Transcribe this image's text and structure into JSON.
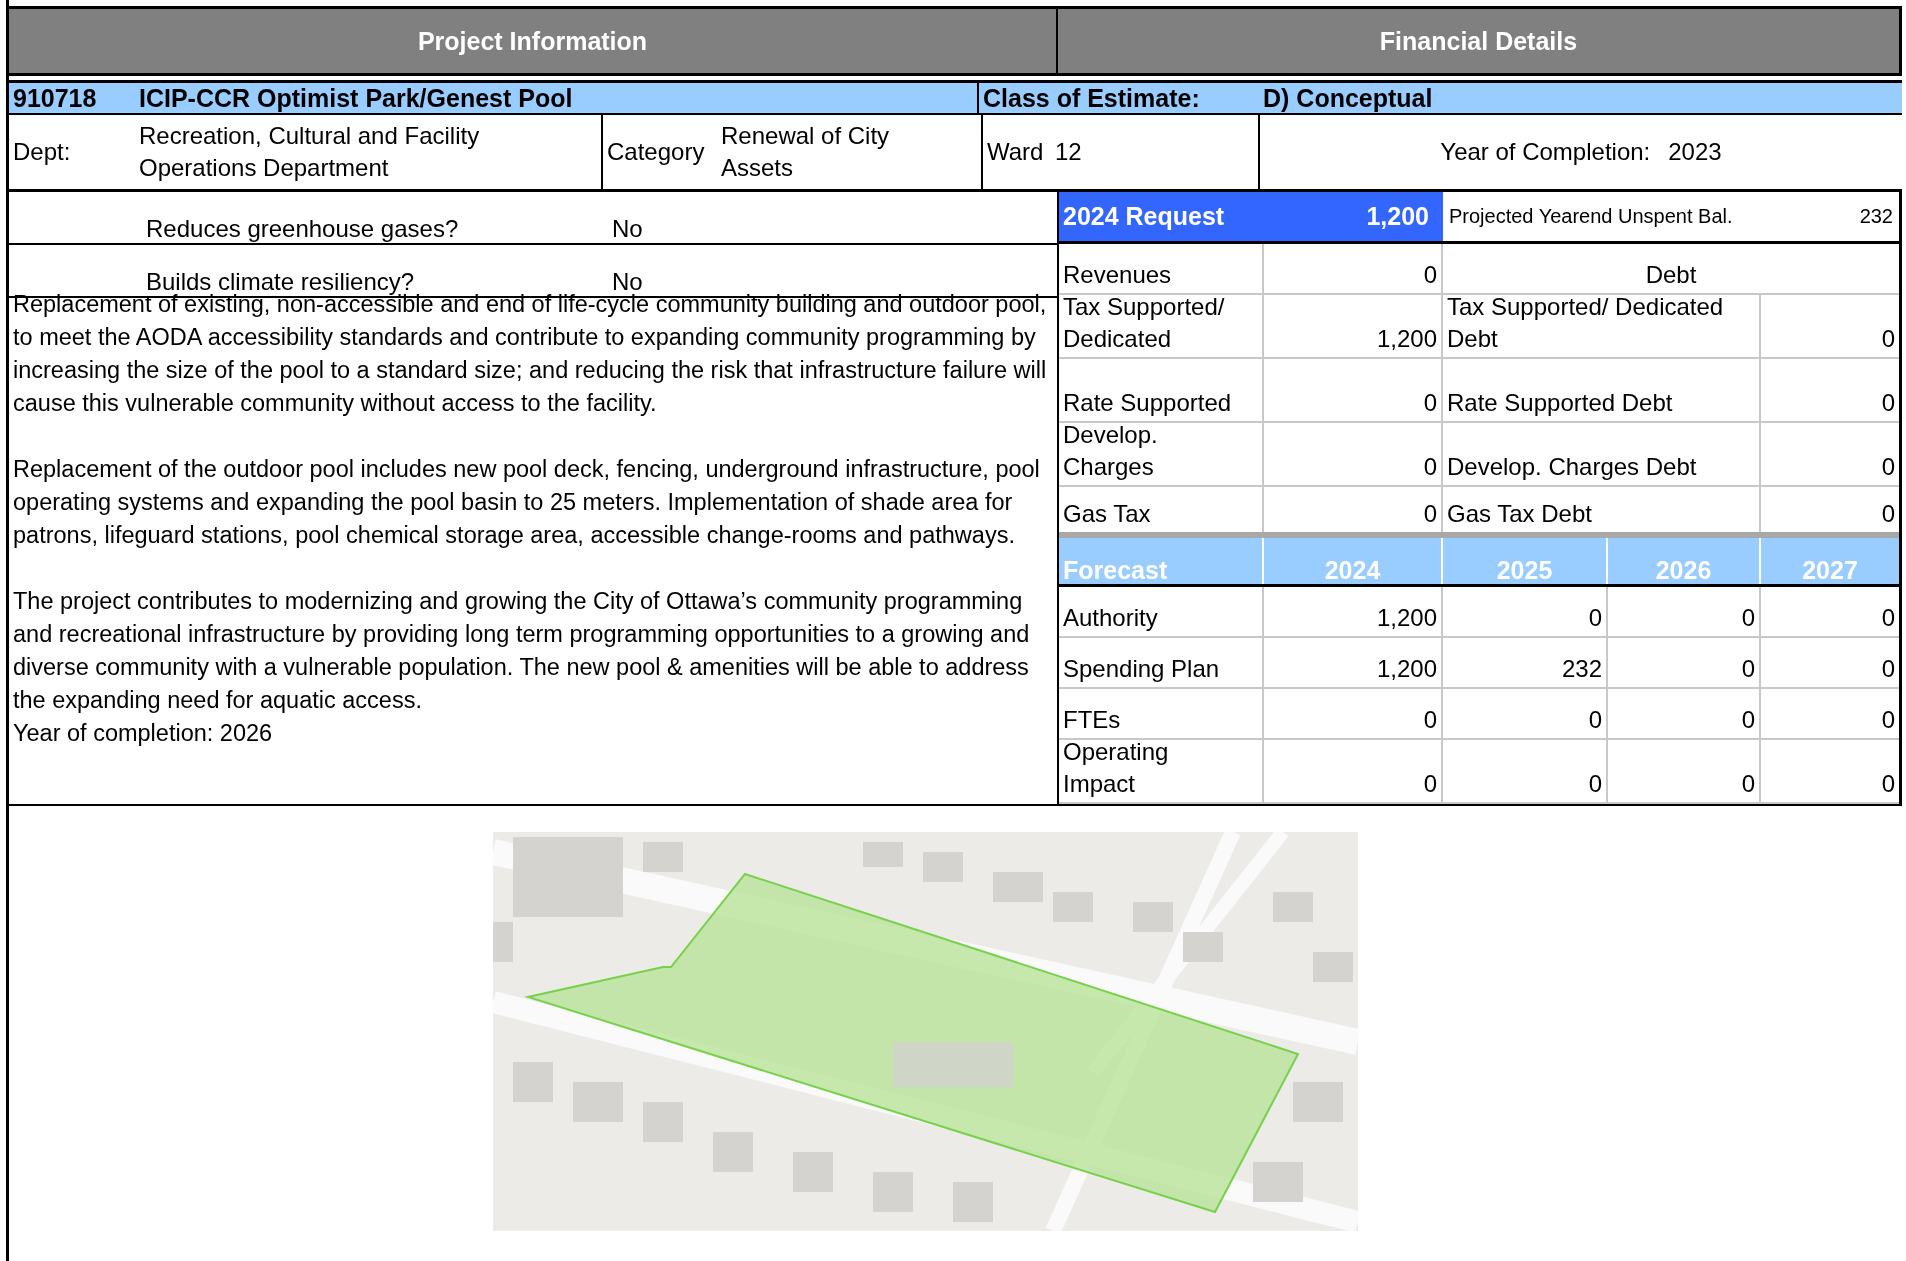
{
  "header": {
    "left_title": "Project Information",
    "right_title": "Financial Details"
  },
  "project": {
    "number": "910718",
    "name": "ICIP-CCR Optimist Park/Genest Pool",
    "class_label": "Class of Estimate:",
    "class_value": "D) Conceptual",
    "dept_label": "Dept:",
    "dept_value": "Recreation, Cultural and Facility\nOperations Department",
    "category_label": "Category",
    "category_value": "Renewal of City\nAssets",
    "ward_label": "Ward",
    "ward_value": "12",
    "completion_label": "Year of Completion:",
    "completion_value": "2023"
  },
  "questions": [
    {
      "question": "Reduces greenhouse gases?",
      "answer": "No"
    },
    {
      "question": "Builds climate resiliency?",
      "answer": "No"
    }
  ],
  "description": {
    "paragraphs": [
      "Replacement of existing, non-accessible and end of life-cycle community building and outdoor pool, to meet the AODA accessibility standards and contribute to expanding community programming by increasing the size of the pool to a standard size; and reducing the risk that infrastructure failure will cause this vulnerable community without access to the facility.",
      "Replacement of the outdoor pool includes new pool deck, fencing, underground infrastructure, pool operating systems and expanding the pool basin to 25 meters. Implementation of shade area for patrons, lifeguard stations, pool chemical storage area, accessible change-rooms and pathways.",
      "The project contributes to modernizing and growing the City of Ottawa’s community programming and recreational infrastructure by providing long term programming opportunities to a growing and diverse community with a vulnerable population. The new pool & amenities will be able to address the expanding need for aquatic access."
    ],
    "completion": "Year of completion: 2026"
  },
  "request": {
    "label": "2024 Request",
    "value": "1,200",
    "unspent_label": "Projected Yearend Unspent Bal.",
    "unspent_value": "232"
  },
  "revenues": {
    "label": "Revenues",
    "value": "0",
    "debt_header": "Debt"
  },
  "funding": [
    {
      "label": "Tax Supported/\nDedicated",
      "value": "1,200",
      "debt_label": "Tax Supported/ Dedicated\nDebt",
      "debt_value": "0"
    },
    {
      "label": "Rate Supported",
      "value": "0",
      "debt_label": "Rate Supported Debt",
      "debt_value": "0"
    },
    {
      "label": "Develop.\nCharges",
      "value": "0",
      "debt_label": "Develop. Charges Debt",
      "debt_value": "0"
    },
    {
      "label": "Gas Tax",
      "value": "0",
      "debt_label": "Gas Tax Debt",
      "debt_value": "0"
    }
  ],
  "forecast": {
    "columns": [
      "Forecast",
      "2024",
      "2025",
      "2026",
      "2027"
    ],
    "rows": [
      {
        "label": "Authority",
        "values": [
          "1,200",
          "0",
          "0",
          "0"
        ]
      },
      {
        "label": "Spending Plan",
        "values": [
          "1,200",
          "232",
          "0",
          "0"
        ]
      },
      {
        "label": "FTEs",
        "values": [
          "0",
          "0",
          "0",
          "0"
        ]
      },
      {
        "label": "Operating\nImpact",
        "values": [
          "0",
          "0",
          "0",
          "0"
        ]
      }
    ]
  }
}
